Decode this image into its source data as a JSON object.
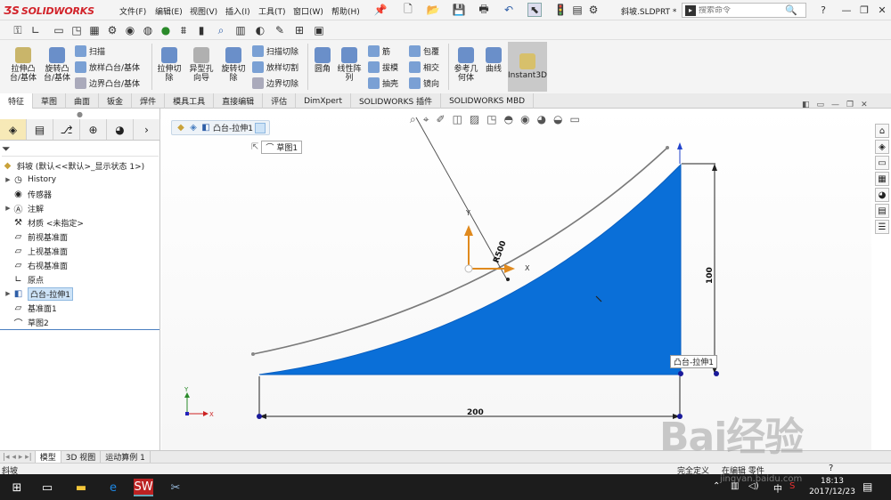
{
  "app": {
    "logo_text": "SOLIDWORKS",
    "doc_title": "斜坡.SLDPRT *"
  },
  "menu": {
    "items": [
      "文件(F)",
      "编辑(E)",
      "视图(V)",
      "插入(I)",
      "工具(T)",
      "窗口(W)",
      "帮助(H)"
    ]
  },
  "search": {
    "placeholder": "搜索命令"
  },
  "ribbon": {
    "extrude_boss": "拉伸凸\n台/基体",
    "revolve_boss": "旋转凸\n台/基体",
    "sweep": "扫描",
    "loft_boss": "放样凸台/基体",
    "boundary_boss": "边界凸台/基体",
    "extrude_cut": "拉伸切\n除",
    "hole_wizard": "异型孔\n向导",
    "revolve_cut": "旋转切\n除",
    "sweep_cut": "扫描切除",
    "loft_cut": "放样切割",
    "boundary_cut": "边界切除",
    "fillet": "圆角",
    "linear_pattern": "线性阵\n列",
    "rib": "筋",
    "draft": "拔模",
    "shell": "抽壳",
    "wrap": "包覆",
    "intersect": "相交",
    "mirror": "镜向",
    "ref_geometry": "参考几\n何体",
    "curves": "曲线",
    "instant3d": "Instant3D"
  },
  "tabs": [
    "特征",
    "草图",
    "曲面",
    "钣金",
    "焊件",
    "模具工具",
    "直接编辑",
    "评估",
    "DimXpert",
    "SOLIDWORKS 插件",
    "SOLIDWORKS MBD"
  ],
  "tree": {
    "root": "斜坡 (默认<<默认>_显示状态 1>)",
    "items": [
      "History",
      "传感器",
      "注解",
      "材质 <未指定>",
      "前视基准面",
      "上视基准面",
      "右视基准面",
      "原点",
      "凸台-拉伸1",
      "基准面1",
      "草图2"
    ]
  },
  "breadcrumb": {
    "feature": "凸台-拉伸1",
    "sketch": "草图1"
  },
  "model": {
    "dim_width": "200",
    "dim_height": "100",
    "dim_radius": "R500",
    "tooltip": "凸台-拉伸1",
    "axis_x": "X",
    "axis_y": "Y",
    "fill_color": "#0a6fd8"
  },
  "bottom_tabs": [
    "模型",
    "3D 视图",
    "运动算例 1"
  ],
  "status": {
    "left": "斜坡",
    "right_a": "完全定义",
    "right_b": "在编辑 零件"
  },
  "taskbar": {
    "time": "18:13",
    "date": "2017/12/23",
    "ime": "中"
  },
  "watermark": {
    "brand": "Bai经验",
    "url": "jingyan.baidu.com"
  }
}
